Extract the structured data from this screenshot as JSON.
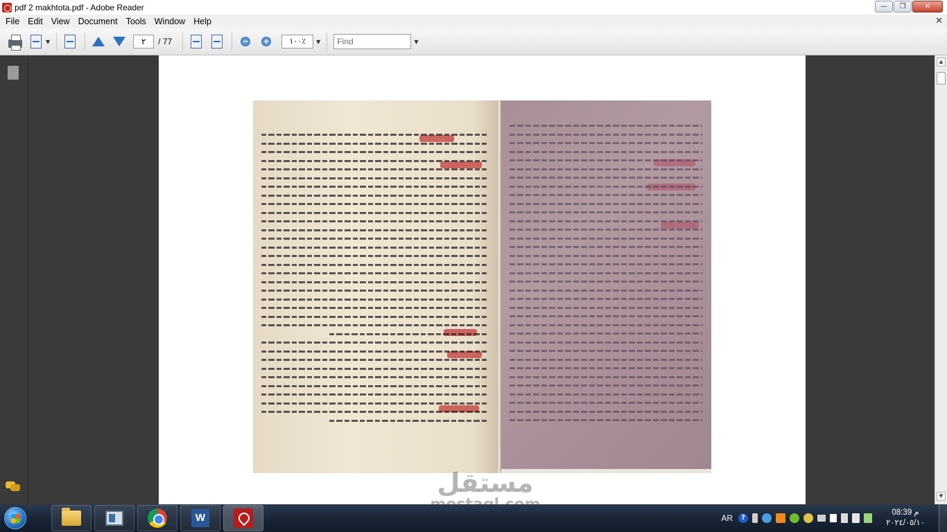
{
  "window": {
    "title": "pdf 2 makhtota.pdf - Adobe Reader",
    "buttons": {
      "minimize": "—",
      "maximize": "❐",
      "close": "✕"
    }
  },
  "menu": {
    "items": [
      "File",
      "Edit",
      "View",
      "Document",
      "Tools",
      "Window",
      "Help"
    ],
    "close_glyph": "✕"
  },
  "toolbar": {
    "page_current": "٢",
    "page_total": "/ 77",
    "zoom": "١٠٠٪",
    "find_placeholder": "Find",
    "zoom_out_glyph": "−",
    "zoom_in_glyph": "+",
    "dropdown_glyph": "▼"
  },
  "icons": {
    "print": "printer-icon",
    "organize": "pages-icon",
    "prev_page": "arrow-up-icon",
    "next_page": "arrow-down-icon",
    "fit_width": "fit-width-icon",
    "fit_page": "fit-page-icon",
    "zoom_out": "zoom-out-icon",
    "zoom_in": "zoom-in-icon",
    "nav_pages": "pages-panel-icon",
    "nav_comments": "comments-icon"
  },
  "watermark": {
    "arabic": "مستقل",
    "latin": "mostaql.com"
  },
  "scrollbar": {
    "up": "▲",
    "down": "▼"
  },
  "taskbar": {
    "apps": [
      "windows-explorer",
      "computer",
      "google-chrome",
      "microsoft-word",
      "adobe-reader"
    ],
    "language": "AR",
    "help_glyph": "?",
    "clock_time": "08:39 م",
    "clock_date": "٢٠٢٤/٠٥/١٠"
  },
  "colors": {
    "reader_red": "#c6241c",
    "dark_bg": "#3a3a3a",
    "arrow_blue": "#2d6fc4",
    "rubric_red": "#c23a3a"
  }
}
